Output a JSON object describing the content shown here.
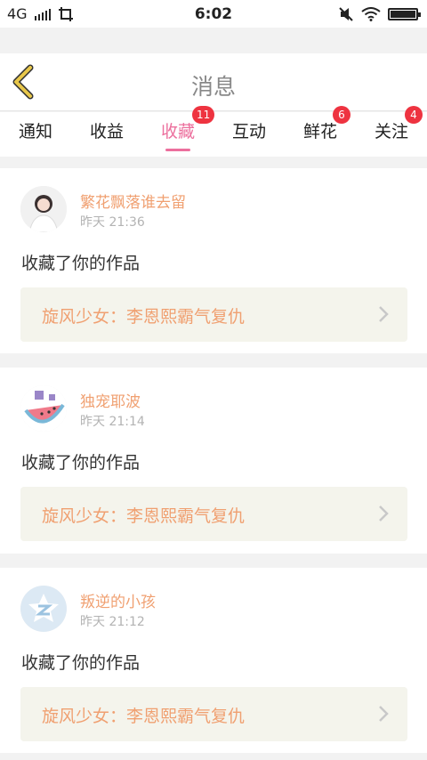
{
  "status_bar": {
    "network": "4G",
    "time": "6:02",
    "battery_level": 1.0
  },
  "header": {
    "title": "消息",
    "back_icon": "chevron-left-icon"
  },
  "tabs": [
    {
      "label": "通知",
      "badge": ""
    },
    {
      "label": "收益",
      "badge": ""
    },
    {
      "label": "收藏",
      "badge": "11",
      "active": true
    },
    {
      "label": "互动",
      "badge": ""
    },
    {
      "label": "鲜花",
      "badge": "6"
    },
    {
      "label": "关注",
      "badge": "4"
    }
  ],
  "colors": {
    "accent": "#ec6f9d",
    "badge": "#ee3340",
    "username": "#f0a071",
    "link_bg": "#f4f4ec",
    "back_arrow": "#e8c74a"
  },
  "items": [
    {
      "username": "繁花飘落谁去留",
      "time": "昨天 21:36",
      "action": "收藏了你的作品",
      "work_title": "旋风少女：李恩熙霸气复仇",
      "avatar": "avatar-photo"
    },
    {
      "username": "独宠耶波",
      "time": "昨天 21:14",
      "action": "收藏了你的作品",
      "work_title": "旋风少女：李恩熙霸气复仇",
      "avatar": "avatar-watermelon"
    },
    {
      "username": "叛逆的小孩",
      "time": "昨天 21:12",
      "action": "收藏了你的作品",
      "work_title": "旋风少女：李恩熙霸气复仇",
      "avatar": "avatar-default"
    }
  ]
}
